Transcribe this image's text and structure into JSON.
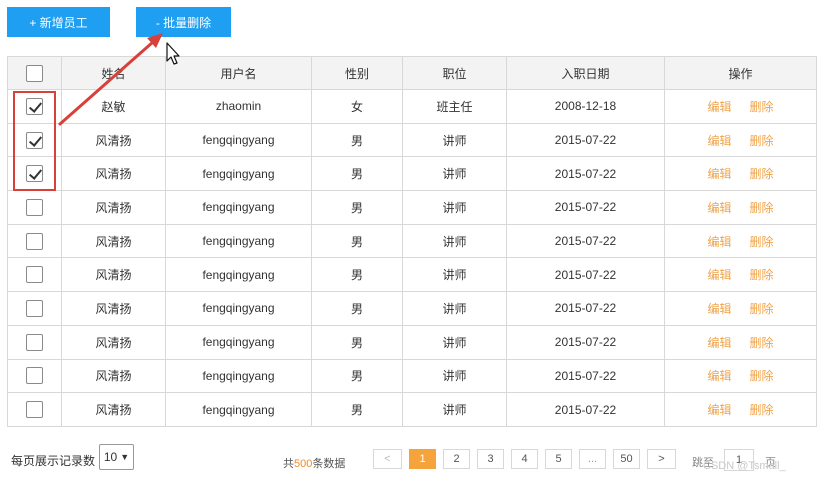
{
  "toolbar": {
    "add_label": "+ 新增员工",
    "batch_delete_label": "- 批量删除"
  },
  "table": {
    "headers": [
      "姓名",
      "用户名",
      "性别",
      "职位",
      "入职日期",
      "操作"
    ],
    "rows": [
      {
        "checked": true,
        "name": "赵敏",
        "username": "zhaomin",
        "gender": "女",
        "position": "班主任",
        "hire_date": "2008-12-18",
        "edit": "编辑",
        "delete": "删除"
      },
      {
        "checked": true,
        "name": "风清扬",
        "username": "fengqingyang",
        "gender": "男",
        "position": "讲师",
        "hire_date": "2015-07-22",
        "edit": "编辑",
        "delete": "删除"
      },
      {
        "checked": true,
        "name": "风清扬",
        "username": "fengqingyang",
        "gender": "男",
        "position": "讲师",
        "hire_date": "2015-07-22",
        "edit": "编辑",
        "delete": "删除"
      },
      {
        "checked": false,
        "name": "风清扬",
        "username": "fengqingyang",
        "gender": "男",
        "position": "讲师",
        "hire_date": "2015-07-22",
        "edit": "编辑",
        "delete": "删除"
      },
      {
        "checked": false,
        "name": "风清扬",
        "username": "fengqingyang",
        "gender": "男",
        "position": "讲师",
        "hire_date": "2015-07-22",
        "edit": "编辑",
        "delete": "删除"
      },
      {
        "checked": false,
        "name": "风清扬",
        "username": "fengqingyang",
        "gender": "男",
        "position": "讲师",
        "hire_date": "2015-07-22",
        "edit": "编辑",
        "delete": "删除"
      },
      {
        "checked": false,
        "name": "风清扬",
        "username": "fengqingyang",
        "gender": "男",
        "position": "讲师",
        "hire_date": "2015-07-22",
        "edit": "编辑",
        "delete": "删除"
      },
      {
        "checked": false,
        "name": "风清扬",
        "username": "fengqingyang",
        "gender": "男",
        "position": "讲师",
        "hire_date": "2015-07-22",
        "edit": "编辑",
        "delete": "删除"
      },
      {
        "checked": false,
        "name": "风清扬",
        "username": "fengqingyang",
        "gender": "男",
        "position": "讲师",
        "hire_date": "2015-07-22",
        "edit": "编辑",
        "delete": "删除"
      },
      {
        "checked": false,
        "name": "风清扬",
        "username": "fengqingyang",
        "gender": "男",
        "position": "讲师",
        "hire_date": "2015-07-22",
        "edit": "编辑",
        "delete": "删除"
      }
    ]
  },
  "footer": {
    "rows_per_page_label": "每页展示记录数",
    "rows_per_page_value": "10",
    "total_prefix": "共",
    "total_count": "500",
    "total_suffix": "条数据",
    "pages": [
      "<",
      "1",
      "2",
      "3",
      "4",
      "5",
      "...",
      "50",
      ">"
    ],
    "current_page": "1",
    "goto_label": "跳至",
    "goto_value": "1",
    "page_unit": "页"
  },
  "watermark": "CSDN @Tsmall_",
  "colors": {
    "primary": "#1e9ff2",
    "accent_orange": "#f7a33b",
    "annotation_red": "#d8403a"
  }
}
